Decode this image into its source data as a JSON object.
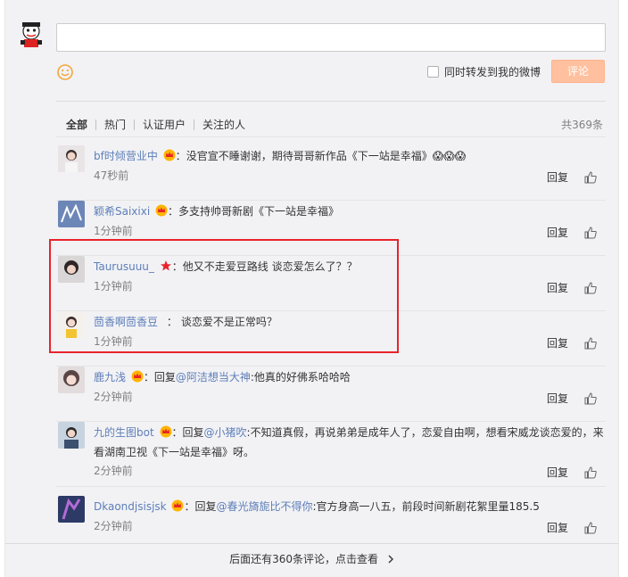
{
  "composer": {
    "placeholder": "",
    "forward_label": "同时转发到我的微博",
    "submit_label": "评论"
  },
  "tabs": [
    {
      "label": "全部",
      "active": true
    },
    {
      "label": "热门",
      "active": false
    },
    {
      "label": "认证用户",
      "active": false
    },
    {
      "label": "关注的人",
      "active": false
    }
  ],
  "total_count": "共369条",
  "comments": [
    {
      "name": "bf时倾营业中",
      "badge": "crown",
      "sep": "：",
      "reply_prefix": "",
      "reply_to": "",
      "text": "没官宣不睡谢谢，期待哥哥新作品《下一站是幸福》😱😱😱",
      "time": "47秒前",
      "reply_label": "回复"
    },
    {
      "name": "颖希Saixixi",
      "badge": "crown",
      "sep": "：",
      "reply_prefix": "",
      "reply_to": "",
      "text": "多支持帅哥新剧《下一站是幸福》",
      "time": "1分钟前",
      "reply_label": "回复"
    },
    {
      "name": "Taurusuuu_",
      "badge": "star",
      "sep": "：",
      "reply_prefix": "",
      "reply_to": "",
      "text": "他又不走爱豆路线 谈恋爱怎么了？？",
      "time": "1分钟前",
      "reply_label": "回复"
    },
    {
      "name": "茴香啊茴香豆",
      "badge": "",
      "sep": " ：",
      "reply_prefix": "",
      "reply_to": "",
      "text": "谈恋爱不是正常吗？",
      "time": "1分钟前",
      "reply_label": "回复"
    },
    {
      "name": "鹿九浅",
      "badge": "crown",
      "sep": "：",
      "reply_prefix": "回复",
      "reply_to": "@阿洁想当大神",
      "text": ":他真的好佛系哈哈哈",
      "time": "2分钟前",
      "reply_label": "回复"
    },
    {
      "name": "九的生图bot",
      "badge": "crown",
      "sep": "：",
      "reply_prefix": "回复",
      "reply_to": "@小猪吹",
      "text": ":不知道真假，再说弟弟是成年人了，恋爱自由啊，想看宋威龙谈恋爱的，来看湖南卫视《下一站是幸福》呀。",
      "time": "2分钟前",
      "reply_label": "回复"
    },
    {
      "name": "Dkaondjsisjsk",
      "badge": "crown",
      "sep": "：",
      "reply_prefix": "回复",
      "reply_to": "@春光旖旎比不得你",
      "text": ":官方身高一八五，前段时间新剧花絮里量185.5",
      "time": "2分钟前",
      "reply_label": "回复"
    }
  ],
  "more_link": "后面还有360条评论，点击查看",
  "colors": {
    "link": "#5d7eb8",
    "submit_bg": "#ffc09f",
    "highlight": "#e8232b",
    "panel_bg": "#f2f2f5"
  }
}
